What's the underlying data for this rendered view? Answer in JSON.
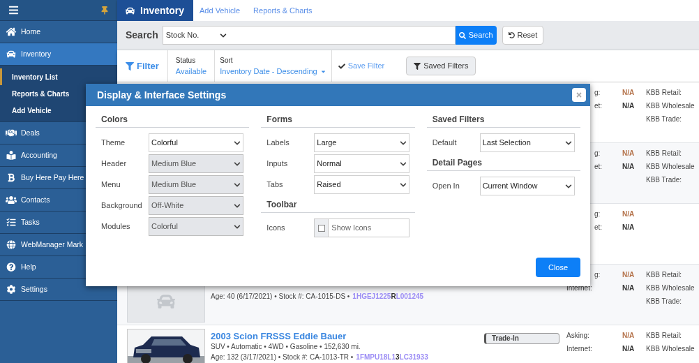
{
  "sidebar": {
    "items": [
      {
        "label": "Home",
        "selected": false
      },
      {
        "label": "Inventory",
        "selected": true,
        "expanded": true,
        "children": [
          {
            "label": "Inventory List",
            "selected": true
          },
          {
            "label": "Reports & Charts",
            "selected": false
          },
          {
            "label": "Add Vehicle",
            "selected": false
          }
        ]
      },
      {
        "label": "Deals",
        "selected": false
      },
      {
        "label": "Accounting",
        "selected": false
      },
      {
        "label": "Buy Here Pay Here",
        "selected": false
      },
      {
        "label": "Contacts",
        "selected": false
      },
      {
        "label": "Tasks",
        "selected": false
      },
      {
        "label": "WebManager Mark",
        "selected": false
      },
      {
        "label": "Help",
        "selected": false
      },
      {
        "label": "Settings",
        "selected": false
      }
    ]
  },
  "header": {
    "title": "Inventory",
    "links": [
      "Add Vehicle",
      "Reports & Charts"
    ]
  },
  "search": {
    "label": "Search",
    "field": "Stock No.",
    "button": "Search",
    "reset": "Reset"
  },
  "filter_bar": {
    "filter": "Filter",
    "status_label": "Status",
    "status": "Available",
    "sort_label": "Sort",
    "sort": "Inventory Date - Descending",
    "save": "Save Filter",
    "saved": "Saved Filters"
  },
  "listing": [
    {
      "asking_label": "g:",
      "asking": "N/A",
      "internet_label": "et:",
      "internet": "N/A",
      "kbb": [
        "KBB Retail:",
        "KBB Wholesale",
        "KBB Trade:"
      ]
    },
    {
      "asking_label": "g:",
      "asking": "N/A",
      "internet_label": "et:",
      "internet": "N/A",
      "kbb": [
        "KBB Retail:",
        "KBB Wholesale",
        "KBB Trade:"
      ]
    },
    {
      "asking_label": "g:",
      "asking": "N/A",
      "internet_label": "et:",
      "internet": "N/A"
    },
    {
      "photo": false,
      "info": "Age: 40 (6/17/2021) • Stock #: CA-1015-DS •",
      "vin": "1HGEJ1225**R**L001245",
      "asking_label": "g:",
      "asking": "N/A",
      "internet_label": "Internet:",
      "internet": "N/A",
      "kbb": [
        "KBB Retail:",
        "KBB Wholesale",
        "KBB Trade:"
      ]
    },
    {
      "photo": true,
      "title": "2003 Scion FRSSS Eddie Bauer",
      "specs": "SUV • Automatic • 4WD • Gasoline • 152,630 mi.",
      "info": "Age: 132 (3/17/2021) • Stock #: CA-1013-TR •",
      "vin": "1FMPU18L1**3**LC31933",
      "badge": "Trade-In",
      "asking_label": "Asking:",
      "asking": "N/A",
      "internet_label": "Internet:",
      "internet": "N/A",
      "kbb": [
        "KBB Retail:",
        "KBB Wholesale"
      ]
    }
  ],
  "dialog": {
    "title": "Display & Interface Settings",
    "columns": [
      [
        {
          "heading": "Colors",
          "fields": [
            {
              "label": "Theme",
              "value": "Colorful",
              "disabled": false
            },
            {
              "label": "Header",
              "value": "Medium Blue",
              "disabled": true
            },
            {
              "label": "Menu",
              "value": "Medium Blue",
              "disabled": true
            },
            {
              "label": "Background",
              "value": "Off-White",
              "disabled": true
            },
            {
              "label": "Modules",
              "value": "Colorful",
              "disabled": true
            }
          ]
        }
      ],
      [
        {
          "heading": "Forms",
          "fields": [
            {
              "label": "Labels",
              "value": "Large",
              "disabled": false
            },
            {
              "label": "Inputs",
              "value": "Normal",
              "disabled": false
            },
            {
              "label": "Tabs",
              "value": "Raised",
              "disabled": false
            }
          ]
        },
        {
          "heading": "Toolbar",
          "fields": [
            {
              "kind": "checkbox",
              "label": "Icons",
              "value": "Show Icons",
              "checked": false
            }
          ]
        }
      ],
      [
        {
          "heading": "Saved Filters",
          "fields": [
            {
              "label": "Default",
              "value": "Last Selection",
              "disabled": false
            }
          ]
        },
        {
          "heading": "Detail Pages",
          "fields": [
            {
              "label": "Open In",
              "value": "Current Window",
              "disabled": false
            }
          ]
        }
      ]
    ],
    "close": "Close"
  }
}
